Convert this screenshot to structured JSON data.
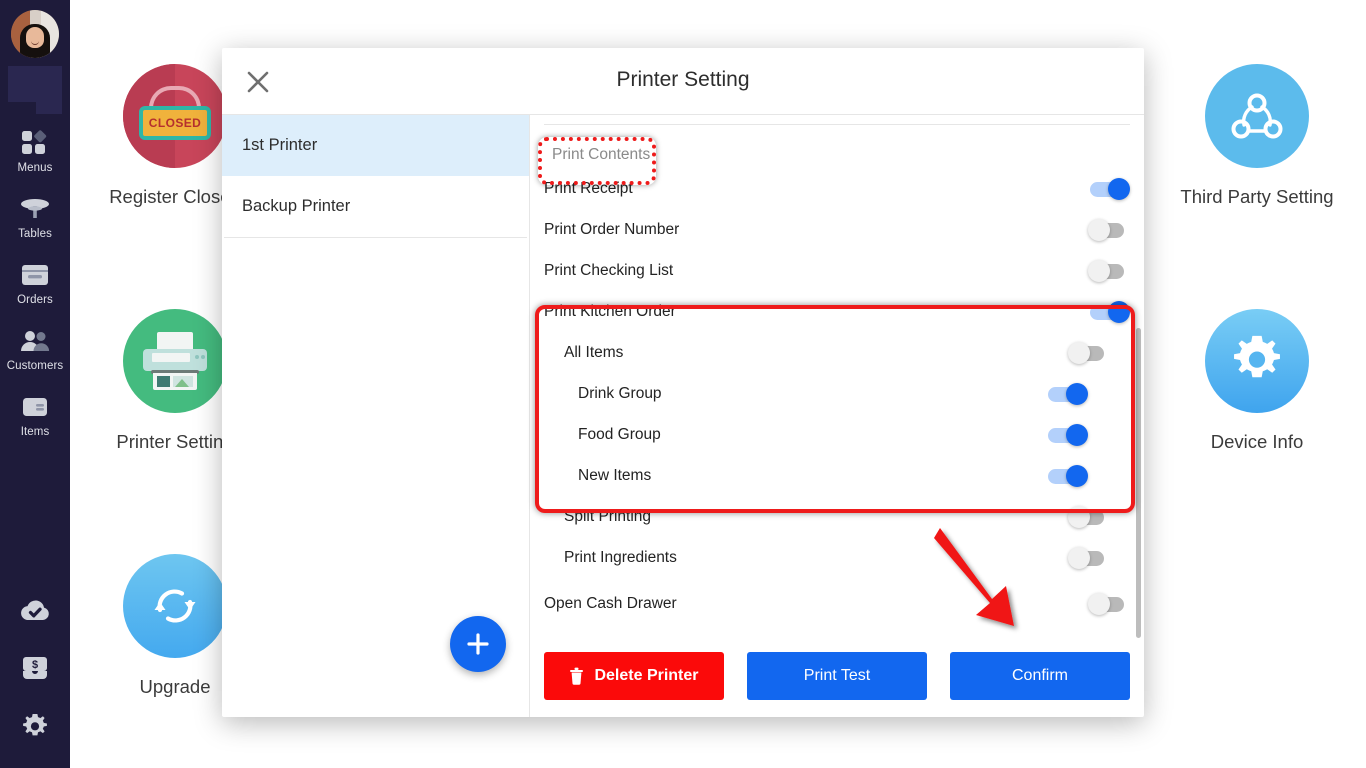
{
  "sidebar": {
    "avatar_name": "avatar",
    "items": [
      {
        "label": "Menus",
        "icon": "grid-icon"
      },
      {
        "label": "Tables",
        "icon": "table-icon"
      },
      {
        "label": "Orders",
        "icon": "orders-icon"
      },
      {
        "label": "Customers",
        "icon": "customers-icon"
      },
      {
        "label": "Items",
        "icon": "items-icon"
      }
    ],
    "bottom_icons": [
      {
        "name": "cloud-check-icon"
      },
      {
        "name": "cash-drawer-icon"
      },
      {
        "name": "gear-icon"
      }
    ]
  },
  "tiles": [
    {
      "label": "Register Closed",
      "icon": "register-closed-icon",
      "color": "#c8455a"
    },
    {
      "label": "Printer Setting",
      "icon": "printer-icon",
      "color": "#44bb7f"
    },
    {
      "label": "Upgrade",
      "icon": "refresh-sync-icon",
      "color": "#52b6ee"
    },
    {
      "label": "Third Party Setting",
      "icon": "share-network-icon",
      "color": "#5cbbec"
    },
    {
      "label": "Device Info",
      "icon": "gear-icon",
      "color": "#4fb0f0"
    }
  ],
  "modal": {
    "title": "Printer Setting",
    "close_icon": "close-icon",
    "printer_list": [
      {
        "label": "1st Printer",
        "selected": true
      },
      {
        "label": "Backup Printer",
        "selected": false
      }
    ],
    "add_printer_icon": "plus-icon",
    "section_header": "Print Contents",
    "rows": [
      {
        "label": "Print Receipt",
        "indent": 0,
        "state": "on"
      },
      {
        "label": "Print Order Number",
        "indent": 0,
        "state": "off"
      },
      {
        "label": "Print Checking List",
        "indent": 0,
        "state": "off"
      },
      {
        "label": "Print Kitchen Order",
        "indent": 0,
        "state": "on"
      },
      {
        "label": "All Items",
        "indent": 1,
        "state": "off"
      },
      {
        "label": "Drink Group",
        "indent": 2,
        "state": "on"
      },
      {
        "label": "Food Group",
        "indent": 2,
        "state": "on"
      },
      {
        "label": "New Items",
        "indent": 2,
        "state": "on"
      },
      {
        "label": "Split Printing",
        "indent": 1,
        "state": "off"
      },
      {
        "label": "Print Ingredients",
        "indent": 1,
        "state": "off"
      },
      {
        "label": "Open Cash Drawer",
        "indent": 0,
        "state": "off"
      }
    ],
    "buttons": {
      "delete": "Delete Printer",
      "delete_icon": "trash-icon",
      "print_test": "Print Test",
      "confirm": "Confirm"
    }
  },
  "annotations": {
    "highlight_box_color": "#ee1b1b",
    "dotted_box_color": "#ee1b1b",
    "arrow_color": "#f01414",
    "arrow_target": "Confirm"
  },
  "colors": {
    "accent_blue": "#1267ef",
    "danger_red": "#fb0a0a",
    "sidebar_bg": "#1e1b3a",
    "selected_row": "#ddeefb"
  }
}
